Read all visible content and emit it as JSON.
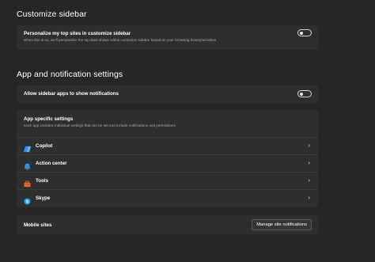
{
  "customize_sidebar": {
    "title": "Customize sidebar",
    "personalize": {
      "title": "Personalize my top sites in customize sidebar",
      "description": "When this is on, we'll personalize the top sites shown within customize sidebar based on your browsing history/activities",
      "toggle_state": "off"
    }
  },
  "app_notifications": {
    "title": "App and notification settings",
    "allow_notifications": {
      "title": "Allow sidebar apps to show notifications",
      "toggle_state": "off"
    },
    "app_specific": {
      "title": "App specific settings",
      "description": "Each app contains individual settings that can be set and include notifications and permissions",
      "apps": [
        {
          "label": "Copilot",
          "icon": "copilot-icon"
        },
        {
          "label": "Action center",
          "icon": "action-center-icon"
        },
        {
          "label": "Tools",
          "icon": "tools-icon"
        },
        {
          "label": "Skype",
          "icon": "skype-icon"
        }
      ]
    },
    "mobile_sites": {
      "label": "Mobile sites",
      "button_label": "Manage site notifications"
    }
  },
  "colors": {
    "background": "#262626",
    "card": "#2e2e2e",
    "text_secondary": "#a8a8a8"
  }
}
